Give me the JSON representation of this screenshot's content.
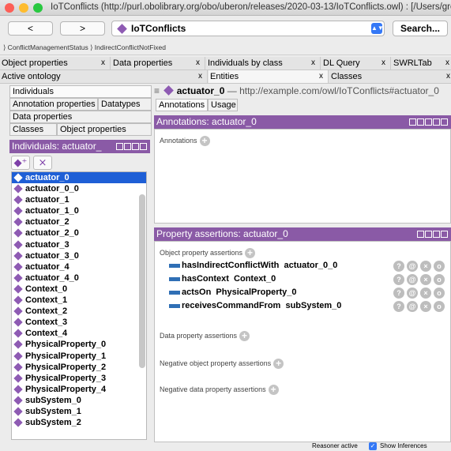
{
  "window": {
    "title": "IoTConflicts (http://purl.obolibrary.org/obo/uberon/releases/2020-03-13/IoTConflicts.owl) : [/Users/gro...",
    "lights": [
      "#fd5f57",
      "#febc2e",
      "#28c840"
    ]
  },
  "toolbar": {
    "back_label": "<",
    "forward_label": ">",
    "ontology_name": "IoTConflicts",
    "search_label": "Search..."
  },
  "breadcrumb": "⟩ ConflictManagementStatus ⟩ IndirectConflictNotFixed",
  "tabs_row1": [
    {
      "label": "Object properties",
      "close": "x"
    },
    {
      "label": "Data properties",
      "close": "x"
    },
    {
      "label": "Individuals by class",
      "close": "x"
    },
    {
      "label": "DL Query",
      "close": "x"
    },
    {
      "label": "SWRLTab",
      "close": "x"
    }
  ],
  "tabs_row2": [
    {
      "label": "Active ontology",
      "close": "x"
    },
    {
      "label": "Entities",
      "close": "x"
    },
    {
      "label": "Classes",
      "close": "x"
    }
  ],
  "left": {
    "tabs": [
      "Individuals",
      "Annotation properties",
      "Datatypes",
      "Data properties",
      "Classes",
      "Object properties"
    ],
    "panel_title": "Individuals: actuator_",
    "add_icon": "◆⁺",
    "delete_icon": "⨯",
    "items": [
      "actuator_0",
      "actuator_0_0",
      "actuator_1",
      "actuator_1_0",
      "actuator_2",
      "actuator_2_0",
      "actuator_3",
      "actuator_3_0",
      "actuator_4",
      "actuator_4_0",
      "Context_0",
      "Context_1",
      "Context_2",
      "Context_3",
      "Context_4",
      "PhysicalProperty_0",
      "PhysicalProperty_1",
      "PhysicalProperty_2",
      "PhysicalProperty_3",
      "PhysicalProperty_4",
      "subSystem_0",
      "subSystem_1",
      "subSystem_2"
    ],
    "selected": "actuator_0"
  },
  "right": {
    "entity_name": "actuator_0",
    "entity_iri": "— http://example.com/owl/IoTConflicts#actuator_0",
    "tabs": [
      "Annotations",
      "Usage"
    ],
    "annotations_header": "Annotations: actuator_0",
    "annotations_label": "Annotations",
    "property_header": "Property assertions: actuator_0",
    "object_label": "Object property assertions",
    "assertions": [
      {
        "prop": "hasIndirectConflictWith",
        "val": "actuator_0_0"
      },
      {
        "prop": "hasContext",
        "val": "Context_0"
      },
      {
        "prop": "actsOn",
        "val": "PhysicalProperty_0"
      },
      {
        "prop": "receivesCommandFrom",
        "val": "subSystem_0"
      }
    ],
    "data_label": "Data property assertions",
    "neg_obj_label": "Negative object property assertions",
    "neg_data_label": "Negative data property assertions",
    "row_buttons": [
      "?",
      "@",
      "×",
      "o"
    ]
  },
  "status": {
    "reasoner": "Reasoner active",
    "show_inferences": "Show Inferences"
  }
}
